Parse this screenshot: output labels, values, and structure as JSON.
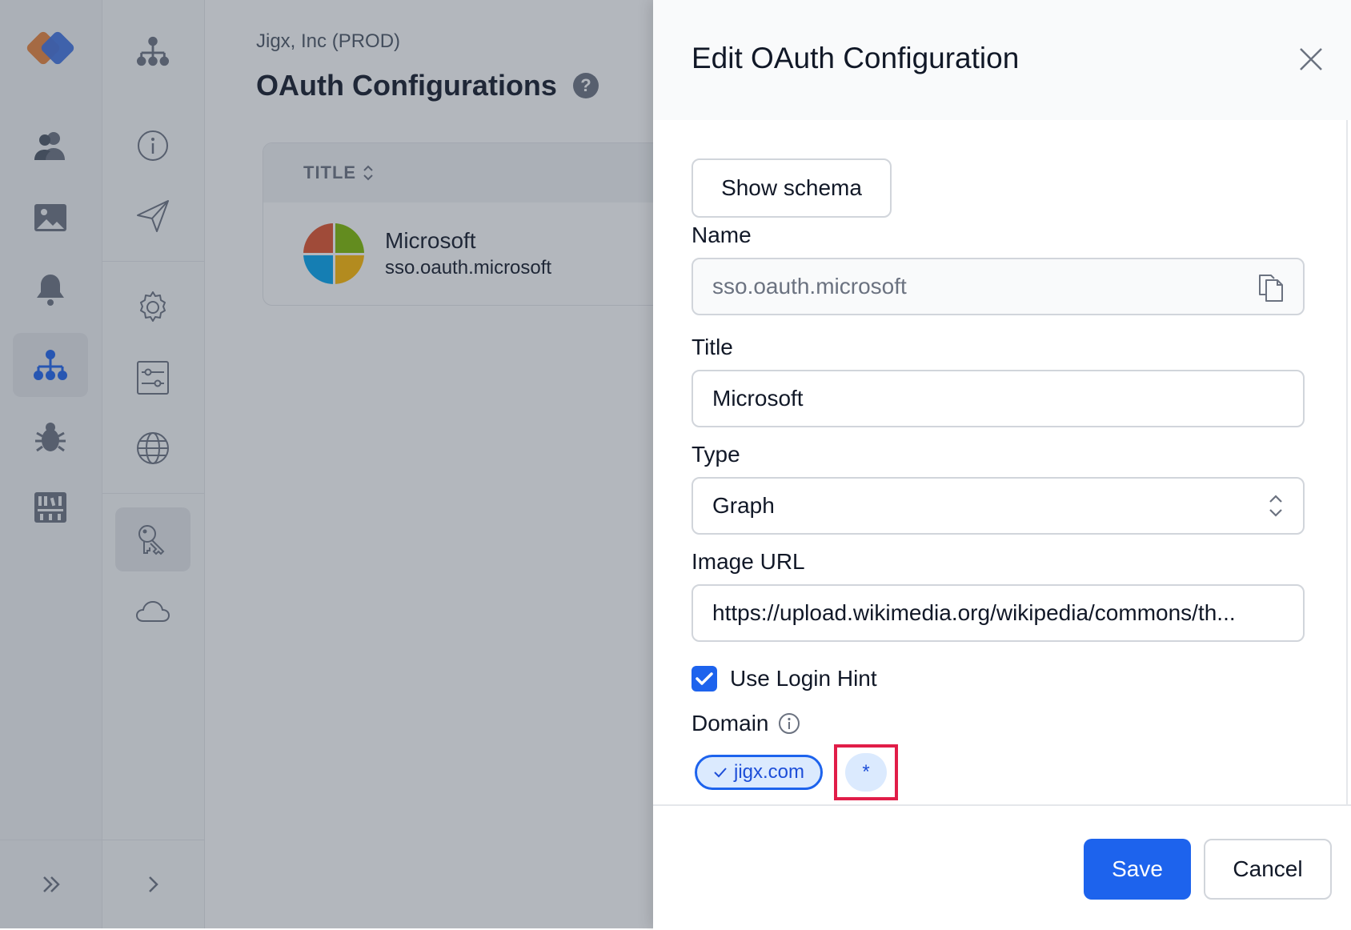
{
  "breadcrumb": "Jigx, Inc (PROD)",
  "page_title": "OAuth Configurations",
  "help_badge": "?",
  "table": {
    "column_title": "TITLE",
    "rows": [
      {
        "title": "Microsoft",
        "subtitle": "sso.oauth.microsoft"
      }
    ]
  },
  "panel": {
    "title": "Edit OAuth Configuration",
    "show_schema_label": "Show schema",
    "name": {
      "label": "Name",
      "value": "sso.oauth.microsoft"
    },
    "title_field": {
      "label": "Title",
      "value": "Microsoft"
    },
    "type": {
      "label": "Type",
      "value": "Graph"
    },
    "image_url": {
      "label": "Image URL",
      "value": "https://upload.wikimedia.org/wikipedia/commons/th..."
    },
    "use_login_hint": {
      "label": "Use Login Hint",
      "checked": true
    },
    "domain": {
      "label": "Domain",
      "chips": [
        {
          "label": "jigx.com",
          "selected": true
        },
        {
          "label": "*",
          "selected": false
        }
      ]
    },
    "save_label": "Save",
    "cancel_label": "Cancel"
  },
  "colors": {
    "primary": "#1d63ed",
    "highlight": "#e11d48",
    "chip_bg": "#dbeafe"
  },
  "icons": {
    "rail": [
      "app-logo",
      "users-icon",
      "image-icon",
      "bell-icon",
      "org-hierarchy-icon",
      "bug-icon",
      "library-icon",
      "double-chevron-right-icon"
    ],
    "subnav": [
      "org-hierarchy-icon",
      "info-icon",
      "send-icon",
      "gear-icon",
      "sliders-icon",
      "globe-icon",
      "keys-icon",
      "cloud-icon",
      "chevron-right-icon"
    ]
  }
}
